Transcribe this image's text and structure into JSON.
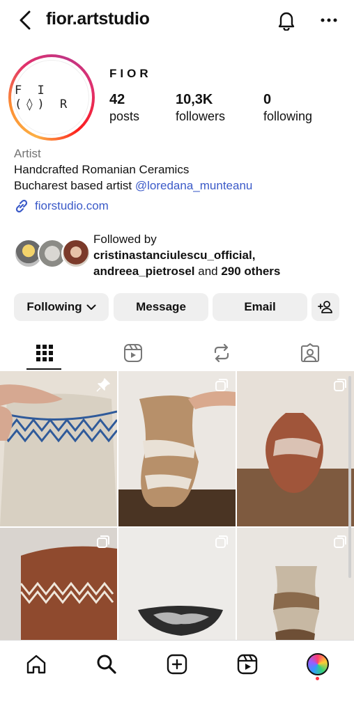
{
  "header": {
    "username": "fior.artstudio",
    "icons": [
      "chevron-left-icon",
      "bell-icon",
      "more-horizontal-icon"
    ]
  },
  "profile": {
    "avatar_text": "F I (◊) R",
    "display_name": "FIOR",
    "stats": [
      {
        "value": "42",
        "label": "posts"
      },
      {
        "value": "10,3K",
        "label": "followers"
      },
      {
        "value": "0",
        "label": "following"
      }
    ],
    "category": "Artist",
    "bio_line1": "Handcrafted Romanian Ceramics",
    "bio_line2_prefix": "Bucharest based artist ",
    "bio_mention": "@loredana_munteanu",
    "link": "fiorstudio.com"
  },
  "followed_by": {
    "label": "Followed by",
    "user1": "cristinastanciulescu_official,",
    "user2": "andreea_pietrosel",
    "and_text": " and ",
    "others": "290 others"
  },
  "actions": {
    "following": "Following",
    "message": "Message",
    "email": "Email"
  },
  "tabs": [
    "grid-icon",
    "reels-icon",
    "reposts-icon",
    "tagged-icon"
  ],
  "grid": [
    {
      "badge": "pin-icon"
    },
    {
      "badge": "carousel-icon"
    },
    {
      "badge": "carousel-icon"
    },
    {
      "badge": "carousel-icon"
    },
    {
      "badge": "carousel-icon"
    },
    {
      "badge": "carousel-icon"
    }
  ],
  "bottom_nav": [
    "home-icon",
    "search-icon",
    "create-icon",
    "reels-icon",
    "profile-avatar"
  ],
  "colors": {
    "accent_link": "#3b5ac8",
    "button_bg": "#efefef",
    "notification_dot": "#ff3040"
  }
}
